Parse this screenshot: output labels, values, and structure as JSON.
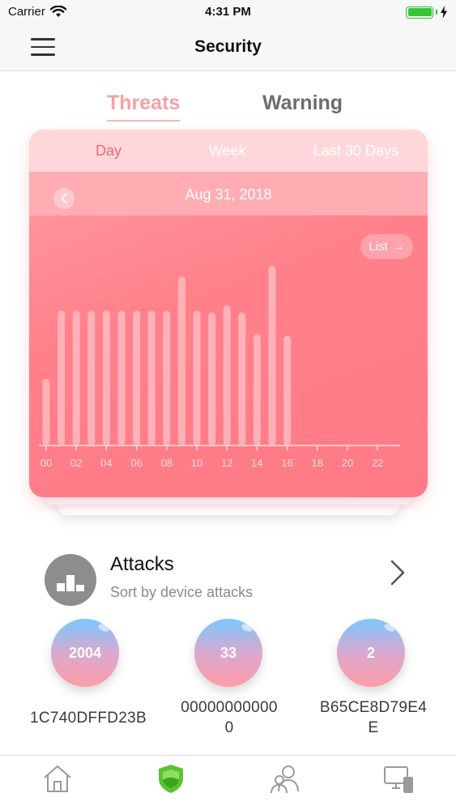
{
  "status_bar": {
    "carrier": "Carrier",
    "time": "4:31 PM"
  },
  "nav": {
    "title": "Security",
    "menu_icon": "hamburger-menu-icon"
  },
  "segments": [
    {
      "label": "Threats",
      "selected": true
    },
    {
      "label": "Warning",
      "selected": false
    }
  ],
  "card": {
    "periods": [
      {
        "label": "Day",
        "selected": true
      },
      {
        "label": "Week",
        "selected": false
      },
      {
        "label": "Last 30 Days",
        "selected": false
      }
    ],
    "date": "Aug 31, 2018",
    "list_button": "List",
    "list_arrow": "→"
  },
  "chart_data": {
    "type": "bar",
    "x_ticks": [
      "00",
      "02",
      "04",
      "06",
      "08",
      "10",
      "12",
      "14",
      "16",
      "18",
      "20",
      "22"
    ],
    "bars": [
      {
        "x": 0,
        "value": 37
      },
      {
        "x": 1,
        "value": 75
      },
      {
        "x": 2,
        "value": 75
      },
      {
        "x": 3,
        "value": 75
      },
      {
        "x": 4,
        "value": 75
      },
      {
        "x": 5,
        "value": 75
      },
      {
        "x": 6,
        "value": 75
      },
      {
        "x": 7,
        "value": 75
      },
      {
        "x": 8,
        "value": 75
      },
      {
        "x": 9,
        "value": 94
      },
      {
        "x": 10,
        "value": 75
      },
      {
        "x": 11,
        "value": 74
      },
      {
        "x": 12,
        "value": 78
      },
      {
        "x": 13,
        "value": 74
      },
      {
        "x": 14,
        "value": 62
      },
      {
        "x": 15,
        "value": 100
      },
      {
        "x": 16,
        "value": 61
      }
    ],
    "ylim": [
      0,
      100
    ],
    "bar_color": "#ffb1b7"
  },
  "attacks": {
    "title": "Attacks",
    "subtitle": "Sort by device attacks",
    "devices": [
      {
        "count": "2004",
        "name_lines": [
          "1C740DFFD23B"
        ]
      },
      {
        "count": "33",
        "name_lines": [
          "00000000000",
          "0"
        ]
      },
      {
        "count": "2",
        "name_lines": [
          "B65CE8D79E4",
          "E"
        ]
      }
    ]
  },
  "tab_bar": [
    {
      "icon": "home-icon",
      "active": false
    },
    {
      "icon": "security-shield-icon",
      "active": true
    },
    {
      "icon": "users-icon",
      "active": false
    },
    {
      "icon": "devices-icon",
      "active": false
    }
  ],
  "colors": {
    "accent_pink": "#ff808b",
    "tab_active": "#5cc233",
    "tab_inactive": "#9a9a9a"
  }
}
